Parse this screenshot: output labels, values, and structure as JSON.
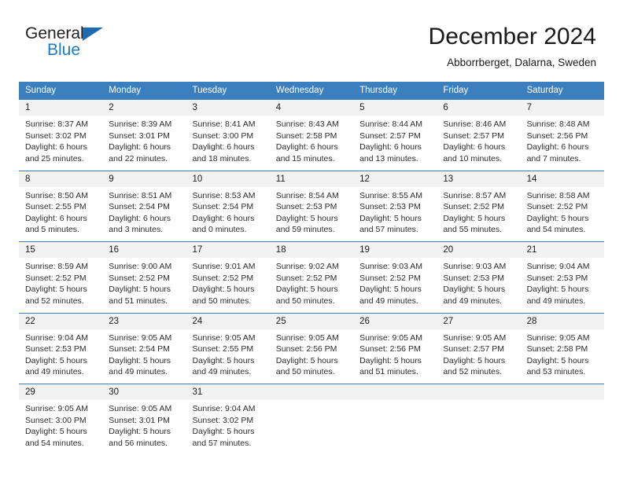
{
  "brand": {
    "name_top": "General",
    "name_bottom": "Blue",
    "triangle_color": "#1b6cb3",
    "blue_color": "#1b7cc4"
  },
  "header": {
    "title": "December 2024",
    "location": "Abborrberget, Dalarna, Sweden"
  },
  "theme": {
    "header_blue": "#3b7fbf",
    "day_band_gray": "#f2f2f2",
    "text": "#1a1a1a"
  },
  "weekdays": [
    "Sunday",
    "Monday",
    "Tuesday",
    "Wednesday",
    "Thursday",
    "Friday",
    "Saturday"
  ],
  "weeks": [
    [
      {
        "day": "1",
        "sunrise": "Sunrise: 8:37 AM",
        "sunset": "Sunset: 3:02 PM",
        "daylight1": "Daylight: 6 hours",
        "daylight2": "and 25 minutes."
      },
      {
        "day": "2",
        "sunrise": "Sunrise: 8:39 AM",
        "sunset": "Sunset: 3:01 PM",
        "daylight1": "Daylight: 6 hours",
        "daylight2": "and 22 minutes."
      },
      {
        "day": "3",
        "sunrise": "Sunrise: 8:41 AM",
        "sunset": "Sunset: 3:00 PM",
        "daylight1": "Daylight: 6 hours",
        "daylight2": "and 18 minutes."
      },
      {
        "day": "4",
        "sunrise": "Sunrise: 8:43 AM",
        "sunset": "Sunset: 2:58 PM",
        "daylight1": "Daylight: 6 hours",
        "daylight2": "and 15 minutes."
      },
      {
        "day": "5",
        "sunrise": "Sunrise: 8:44 AM",
        "sunset": "Sunset: 2:57 PM",
        "daylight1": "Daylight: 6 hours",
        "daylight2": "and 13 minutes."
      },
      {
        "day": "6",
        "sunrise": "Sunrise: 8:46 AM",
        "sunset": "Sunset: 2:57 PM",
        "daylight1": "Daylight: 6 hours",
        "daylight2": "and 10 minutes."
      },
      {
        "day": "7",
        "sunrise": "Sunrise: 8:48 AM",
        "sunset": "Sunset: 2:56 PM",
        "daylight1": "Daylight: 6 hours",
        "daylight2": "and 7 minutes."
      }
    ],
    [
      {
        "day": "8",
        "sunrise": "Sunrise: 8:50 AM",
        "sunset": "Sunset: 2:55 PM",
        "daylight1": "Daylight: 6 hours",
        "daylight2": "and 5 minutes."
      },
      {
        "day": "9",
        "sunrise": "Sunrise: 8:51 AM",
        "sunset": "Sunset: 2:54 PM",
        "daylight1": "Daylight: 6 hours",
        "daylight2": "and 3 minutes."
      },
      {
        "day": "10",
        "sunrise": "Sunrise: 8:53 AM",
        "sunset": "Sunset: 2:54 PM",
        "daylight1": "Daylight: 6 hours",
        "daylight2": "and 0 minutes."
      },
      {
        "day": "11",
        "sunrise": "Sunrise: 8:54 AM",
        "sunset": "Sunset: 2:53 PM",
        "daylight1": "Daylight: 5 hours",
        "daylight2": "and 59 minutes."
      },
      {
        "day": "12",
        "sunrise": "Sunrise: 8:55 AM",
        "sunset": "Sunset: 2:53 PM",
        "daylight1": "Daylight: 5 hours",
        "daylight2": "and 57 minutes."
      },
      {
        "day": "13",
        "sunrise": "Sunrise: 8:57 AM",
        "sunset": "Sunset: 2:52 PM",
        "daylight1": "Daylight: 5 hours",
        "daylight2": "and 55 minutes."
      },
      {
        "day": "14",
        "sunrise": "Sunrise: 8:58 AM",
        "sunset": "Sunset: 2:52 PM",
        "daylight1": "Daylight: 5 hours",
        "daylight2": "and 54 minutes."
      }
    ],
    [
      {
        "day": "15",
        "sunrise": "Sunrise: 8:59 AM",
        "sunset": "Sunset: 2:52 PM",
        "daylight1": "Daylight: 5 hours",
        "daylight2": "and 52 minutes."
      },
      {
        "day": "16",
        "sunrise": "Sunrise: 9:00 AM",
        "sunset": "Sunset: 2:52 PM",
        "daylight1": "Daylight: 5 hours",
        "daylight2": "and 51 minutes."
      },
      {
        "day": "17",
        "sunrise": "Sunrise: 9:01 AM",
        "sunset": "Sunset: 2:52 PM",
        "daylight1": "Daylight: 5 hours",
        "daylight2": "and 50 minutes."
      },
      {
        "day": "18",
        "sunrise": "Sunrise: 9:02 AM",
        "sunset": "Sunset: 2:52 PM",
        "daylight1": "Daylight: 5 hours",
        "daylight2": "and 50 minutes."
      },
      {
        "day": "19",
        "sunrise": "Sunrise: 9:03 AM",
        "sunset": "Sunset: 2:52 PM",
        "daylight1": "Daylight: 5 hours",
        "daylight2": "and 49 minutes."
      },
      {
        "day": "20",
        "sunrise": "Sunrise: 9:03 AM",
        "sunset": "Sunset: 2:53 PM",
        "daylight1": "Daylight: 5 hours",
        "daylight2": "and 49 minutes."
      },
      {
        "day": "21",
        "sunrise": "Sunrise: 9:04 AM",
        "sunset": "Sunset: 2:53 PM",
        "daylight1": "Daylight: 5 hours",
        "daylight2": "and 49 minutes."
      }
    ],
    [
      {
        "day": "22",
        "sunrise": "Sunrise: 9:04 AM",
        "sunset": "Sunset: 2:53 PM",
        "daylight1": "Daylight: 5 hours",
        "daylight2": "and 49 minutes."
      },
      {
        "day": "23",
        "sunrise": "Sunrise: 9:05 AM",
        "sunset": "Sunset: 2:54 PM",
        "daylight1": "Daylight: 5 hours",
        "daylight2": "and 49 minutes."
      },
      {
        "day": "24",
        "sunrise": "Sunrise: 9:05 AM",
        "sunset": "Sunset: 2:55 PM",
        "daylight1": "Daylight: 5 hours",
        "daylight2": "and 49 minutes."
      },
      {
        "day": "25",
        "sunrise": "Sunrise: 9:05 AM",
        "sunset": "Sunset: 2:56 PM",
        "daylight1": "Daylight: 5 hours",
        "daylight2": "and 50 minutes."
      },
      {
        "day": "26",
        "sunrise": "Sunrise: 9:05 AM",
        "sunset": "Sunset: 2:56 PM",
        "daylight1": "Daylight: 5 hours",
        "daylight2": "and 51 minutes."
      },
      {
        "day": "27",
        "sunrise": "Sunrise: 9:05 AM",
        "sunset": "Sunset: 2:57 PM",
        "daylight1": "Daylight: 5 hours",
        "daylight2": "and 52 minutes."
      },
      {
        "day": "28",
        "sunrise": "Sunrise: 9:05 AM",
        "sunset": "Sunset: 2:58 PM",
        "daylight1": "Daylight: 5 hours",
        "daylight2": "and 53 minutes."
      }
    ],
    [
      {
        "day": "29",
        "sunrise": "Sunrise: 9:05 AM",
        "sunset": "Sunset: 3:00 PM",
        "daylight1": "Daylight: 5 hours",
        "daylight2": "and 54 minutes."
      },
      {
        "day": "30",
        "sunrise": "Sunrise: 9:05 AM",
        "sunset": "Sunset: 3:01 PM",
        "daylight1": "Daylight: 5 hours",
        "daylight2": "and 56 minutes."
      },
      {
        "day": "31",
        "sunrise": "Sunrise: 9:04 AM",
        "sunset": "Sunset: 3:02 PM",
        "daylight1": "Daylight: 5 hours",
        "daylight2": "and 57 minutes."
      },
      {
        "day": "",
        "sunrise": "",
        "sunset": "",
        "daylight1": "",
        "daylight2": ""
      },
      {
        "day": "",
        "sunrise": "",
        "sunset": "",
        "daylight1": "",
        "daylight2": ""
      },
      {
        "day": "",
        "sunrise": "",
        "sunset": "",
        "daylight1": "",
        "daylight2": ""
      },
      {
        "day": "",
        "sunrise": "",
        "sunset": "",
        "daylight1": "",
        "daylight2": ""
      }
    ]
  ]
}
